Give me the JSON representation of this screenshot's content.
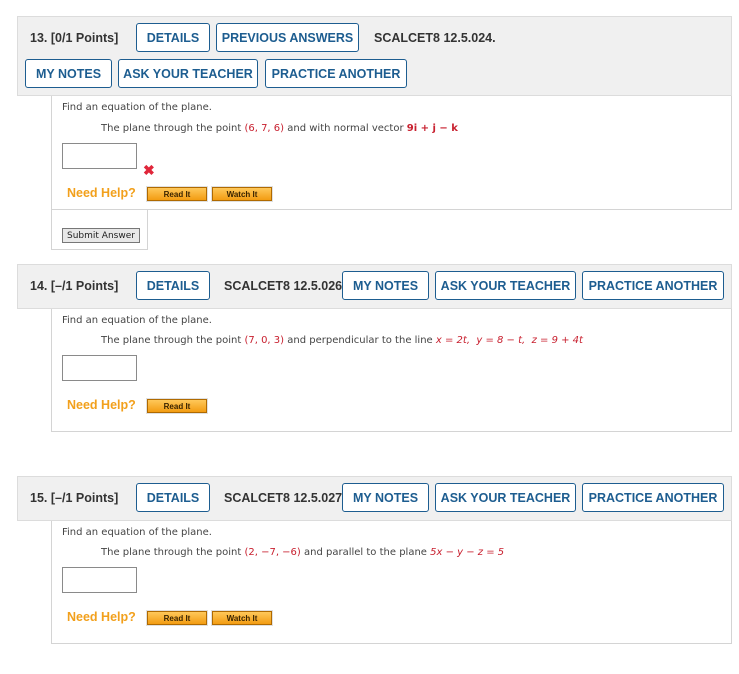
{
  "q13": {
    "number": "13.",
    "points": "[0/1 Points]",
    "details": "DETAILS",
    "previous_answers": "PREVIOUS ANSWERS",
    "code": "SCALCET8 12.5.024.",
    "my_notes": "MY NOTES",
    "ask_teacher": "ASK YOUR TEACHER",
    "practice": "PRACTICE ANOTHER",
    "prompt": "Find an equation of the plane.",
    "detail_a": "The plane through the point ",
    "point": "(6, 7, 6)",
    "detail_b": " and with normal vector ",
    "vector": "9i + j − k",
    "answer": "",
    "need_help": "Need Help?",
    "read_it": "Read It",
    "watch_it": "Watch It",
    "submit": "Submit Answer"
  },
  "q14": {
    "number": "14.",
    "points": "[–/1 Points]",
    "details": "DETAILS",
    "code": "SCALCET8 12.5.026.",
    "my_notes": "MY NOTES",
    "ask_teacher": "ASK YOUR TEACHER",
    "practice": "PRACTICE ANOTHER",
    "prompt": "Find an equation of the plane.",
    "detail_a": "The plane through the point ",
    "point": "(7, 0, 3)",
    "detail_b": " and perpendicular to the line ",
    "line_x": "x = 2t,",
    "line_y": "y = 8 − t,",
    "line_z": "z = 9 + 4t",
    "answer": "",
    "need_help": "Need Help?",
    "read_it": "Read It"
  },
  "q15": {
    "number": "15.",
    "points": "[–/1 Points]",
    "details": "DETAILS",
    "code": "SCALCET8 12.5.027.",
    "my_notes": "MY NOTES",
    "ask_teacher": "ASK YOUR TEACHER",
    "practice": "PRACTICE ANOTHER",
    "prompt": "Find an equation of the plane.",
    "detail_a": "The plane through the point ",
    "point": "(2, −7, −6)",
    "detail_b": " and parallel to the plane ",
    "plane": "5x − y − z = 5",
    "answer": "",
    "need_help": "Need Help?",
    "read_it": "Read It",
    "watch_it": "Watch It"
  },
  "icons": {
    "incorrect": "x-mark-icon"
  },
  "colors": {
    "accent": "#1d5d90",
    "math_red": "#c8202f",
    "help_orange": "#f2a01c",
    "error": "#e0263a"
  }
}
